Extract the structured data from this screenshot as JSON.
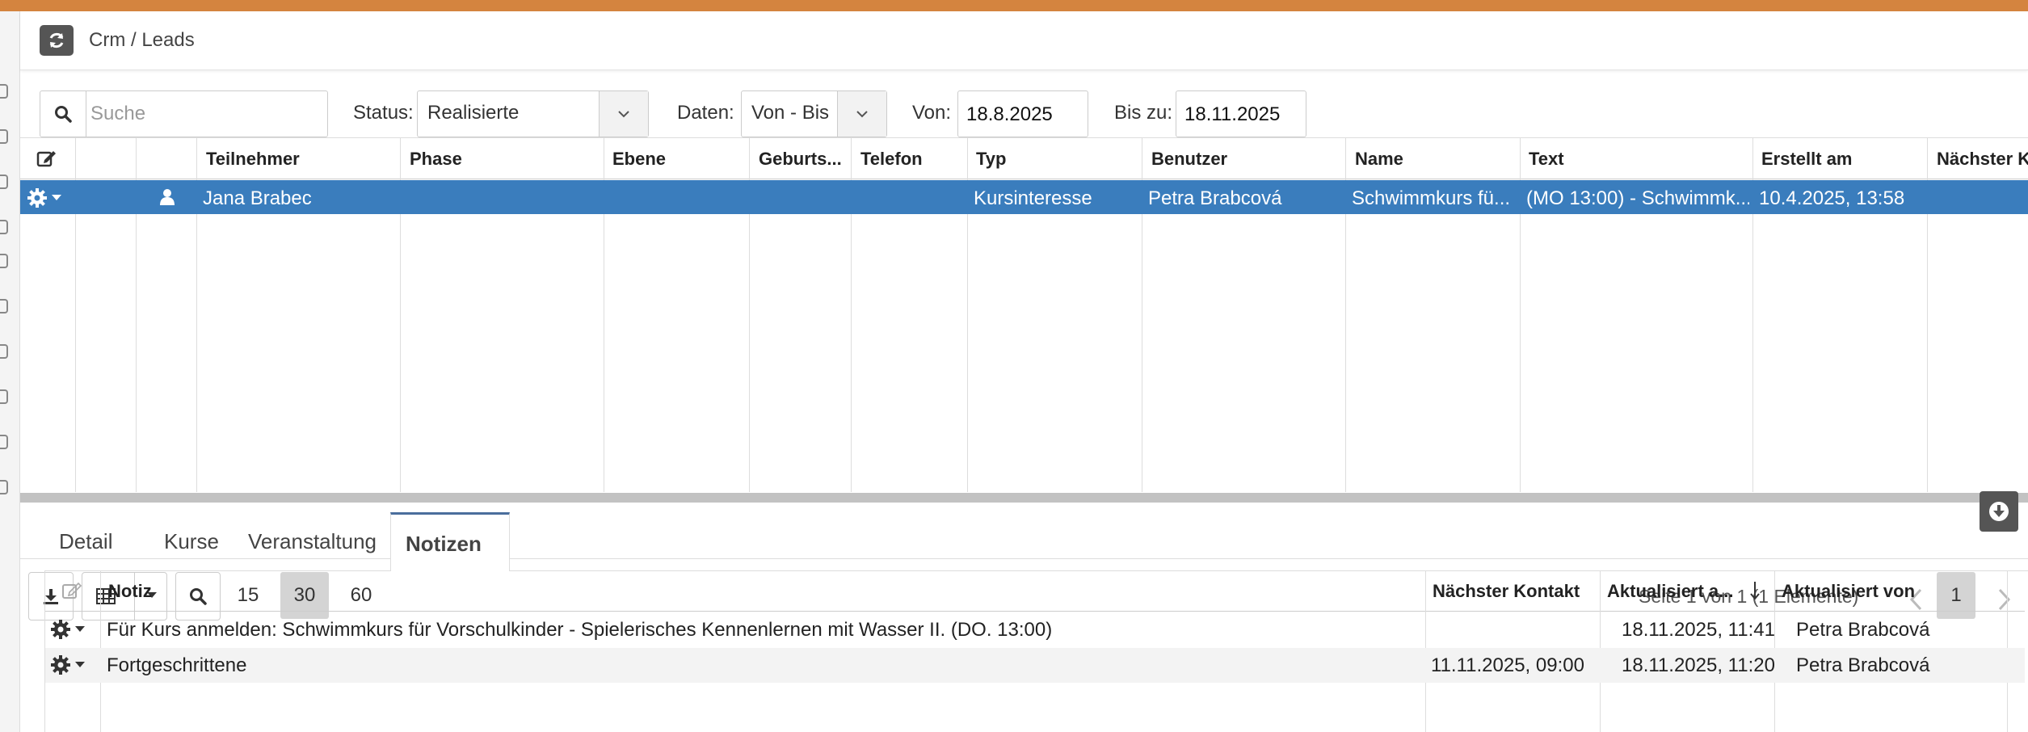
{
  "header": {
    "breadcrumb": "Crm / Leads"
  },
  "filters": {
    "search_placeholder": "Suche",
    "status_label": "Status:",
    "status_value": "Realisierte",
    "dates_label": "Daten:",
    "dates_value": "Von - Bis",
    "from_label": "Von:",
    "from_value": "18.8.2025",
    "to_label": "Bis zu:",
    "to_value": "18.11.2025"
  },
  "grid": {
    "columns": [
      "Teilnehmer",
      "Phase",
      "Ebene",
      "Geburts...",
      "Telefon",
      "Typ",
      "Benutzer",
      "Name",
      "Text",
      "Erstellt am",
      "Nächster K"
    ],
    "rows": [
      {
        "teilnehmer": "Jana Brabec",
        "phase": "",
        "ebene": "",
        "geburts": "",
        "telefon": "",
        "typ": "Kursinteresse",
        "benutzer": "Petra Brabcová",
        "name": "Schwimmkurs fü...",
        "text": "(MO 13:00) - Schwimmk...",
        "erstellt": "10.4.2025, 13:58",
        "naechster": ""
      }
    ]
  },
  "pager": {
    "page_sizes": [
      "15",
      "30",
      "60"
    ],
    "active_page_size": "30",
    "info": "Seite 1 von 1 (1 Elemente)",
    "current_page": "1"
  },
  "tabs": [
    "Detail",
    "Kurse",
    "Veranstaltung",
    "Notizen"
  ],
  "active_tab": "Notizen",
  "notes": {
    "columns": [
      "Notiz",
      "Nächster Kontakt",
      "Aktualisiert a...",
      "Aktualisiert von"
    ],
    "rows": [
      {
        "notiz": "Für Kurs anmelden: Schwimmkurs für Vorschulkinder - Spielerisches Kennenlernen mit Wasser II. (DO. 13:00)",
        "kontakt": "",
        "aktualisiert": "18.11.2025, 11:41",
        "von": "Petra Brabcová"
      },
      {
        "notiz": "Fortgeschrittene",
        "kontakt": "11.11.2025, 09:00",
        "aktualisiert": "18.11.2025, 11:20",
        "von": "Petra Brabcová"
      }
    ]
  },
  "colors": {
    "accent_top": "#d4843f",
    "selected_row": "#3a7dbd",
    "tab_active": "#4a6e9c"
  },
  "icons": [
    "refresh-icon",
    "search-icon",
    "chevron-down-icon",
    "edit-icon",
    "gear-icon",
    "user-icon",
    "download-icon",
    "table-icon",
    "caret-down-icon",
    "chevron-left-icon",
    "chevron-right-icon",
    "sort-desc-icon",
    "circle-download-icon"
  ]
}
